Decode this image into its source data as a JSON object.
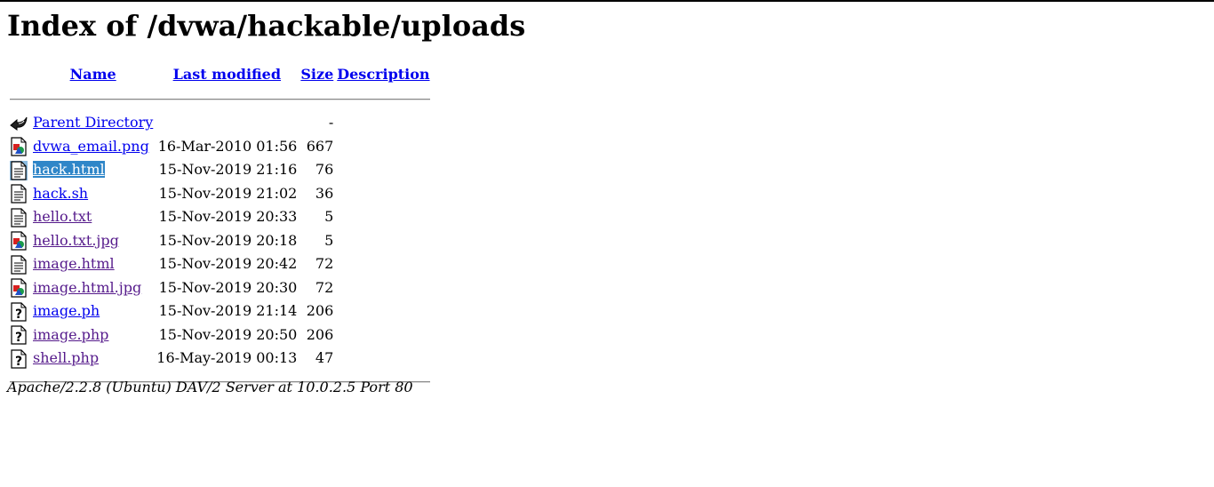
{
  "page": {
    "title": "Index of /dvwa/hackable/uploads"
  },
  "columns": {
    "name": "Name",
    "last_modified": "Last modified",
    "size": "Size",
    "description": "Description"
  },
  "files": [
    {
      "name": "Parent Directory",
      "date": "",
      "size": "-",
      "icon": "back-icon",
      "visited": false,
      "selected": false
    },
    {
      "name": "dvwa_email.png",
      "date": "16-Mar-2010 01:56",
      "size": "667",
      "icon": "image-file-icon",
      "visited": false,
      "selected": false
    },
    {
      "name": "hack.html",
      "date": "15-Nov-2019 21:16",
      "size": "76",
      "icon": "text-file-icon",
      "visited": false,
      "selected": true
    },
    {
      "name": "hack.sh",
      "date": "15-Nov-2019 21:02",
      "size": "36",
      "icon": "text-file-icon",
      "visited": false,
      "selected": false
    },
    {
      "name": "hello.txt",
      "date": "15-Nov-2019 20:33",
      "size": "5",
      "icon": "text-file-icon",
      "visited": true,
      "selected": false
    },
    {
      "name": "hello.txt.jpg",
      "date": "15-Nov-2019 20:18",
      "size": "5",
      "icon": "image-file-icon",
      "visited": true,
      "selected": false
    },
    {
      "name": "image.html",
      "date": "15-Nov-2019 20:42",
      "size": "72",
      "icon": "text-file-icon",
      "visited": true,
      "selected": false
    },
    {
      "name": "image.html.jpg",
      "date": "15-Nov-2019 20:30",
      "size": "72",
      "icon": "image-file-icon",
      "visited": true,
      "selected": false
    },
    {
      "name": "image.ph",
      "date": "15-Nov-2019 21:14",
      "size": "206",
      "icon": "unknown-file-icon",
      "visited": false,
      "selected": false
    },
    {
      "name": "image.php",
      "date": "15-Nov-2019 20:50",
      "size": "206",
      "icon": "unknown-file-icon",
      "visited": true,
      "selected": false
    },
    {
      "name": "shell.php",
      "date": "16-May-2019 00:13",
      "size": "47",
      "icon": "unknown-file-icon",
      "visited": true,
      "selected": false
    }
  ],
  "footer": {
    "server": "Apache/2.2.8 (Ubuntu) DAV/2 Server at 10.0.2.5 Port 80"
  },
  "colors": {
    "link": "#0000ee",
    "visited": "#551a8b",
    "selection": "#2f86c8"
  }
}
